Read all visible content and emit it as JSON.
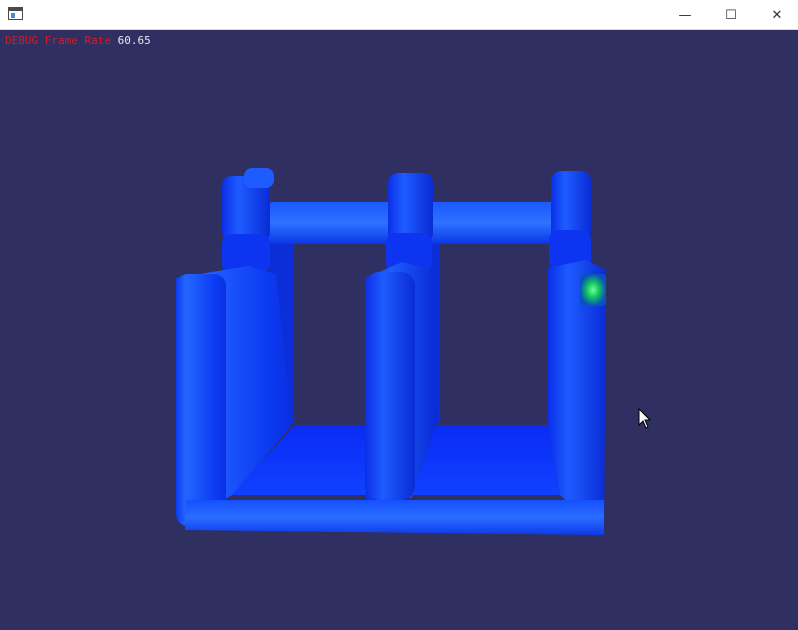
{
  "window": {
    "minimize_glyph": "—",
    "maximize_glyph": "☐",
    "close_glyph": "✕"
  },
  "debug": {
    "label": "DEBUG Frame Rate",
    "value": "60.65"
  },
  "scene": {
    "background": "#2f2f61",
    "structure_color": "#0a3cff",
    "highlight_color": "#3aa0ff",
    "marker_color": "#00e08a"
  }
}
